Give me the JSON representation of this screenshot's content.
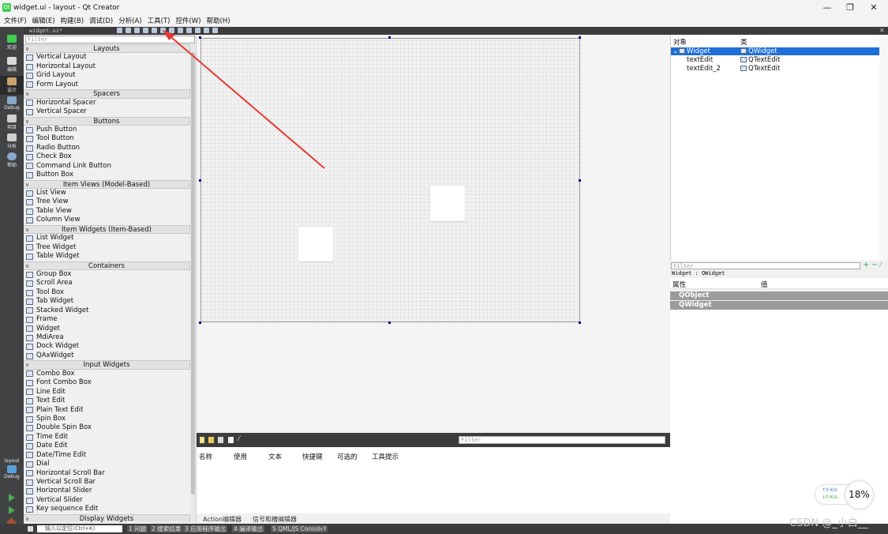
{
  "window": {
    "title": "widget.ui - layout - Qt Creator",
    "app_icon": "Qt",
    "minimize": "—",
    "maximize": "❐",
    "close": "✕"
  },
  "menu": [
    "文件(F)",
    "编辑(E)",
    "构建(B)",
    "调试(D)",
    "分析(A)",
    "工具(T)",
    "控件(W)",
    "帮助(H)"
  ],
  "modes": {
    "welcome": "欢迎",
    "edit": "编辑",
    "design": "设计",
    "debug": "Debug",
    "projects": "项目",
    "analyze": "分析",
    "help": "帮助",
    "kit_label": "layout",
    "kit_mode": "Debug"
  },
  "widget_box": {
    "doc_tab": "widget.ui*",
    "filter_placeholder": "Filter",
    "categories": [
      {
        "name": "Layouts",
        "items": [
          "Vertical Layout",
          "Horizontal Layout",
          "Grid Layout",
          "Form Layout"
        ]
      },
      {
        "name": "Spacers",
        "items": [
          "Horizontal Spacer",
          "Vertical Spacer"
        ]
      },
      {
        "name": "Buttons",
        "items": [
          "Push Button",
          "Tool Button",
          "Radio Button",
          "Check Box",
          "Command Link Button",
          "Button Box"
        ]
      },
      {
        "name": "Item Views (Model-Based)",
        "items": [
          "List View",
          "Tree View",
          "Table View",
          "Column View"
        ]
      },
      {
        "name": "Item Widgets (Item-Based)",
        "items": [
          "List Widget",
          "Tree Widget",
          "Table Widget"
        ]
      },
      {
        "name": "Containers",
        "items": [
          "Group Box",
          "Scroll Area",
          "Tool Box",
          "Tab Widget",
          "Stacked Widget",
          "Frame",
          "Widget",
          "MdiArea",
          "Dock Widget",
          "QAxWidget"
        ]
      },
      {
        "name": "Input Widgets",
        "items": [
          "Combo Box",
          "Font Combo Box",
          "Line Edit",
          "Text Edit",
          "Plain Text Edit",
          "Spin Box",
          "Double Spin Box",
          "Time Edit",
          "Date Edit",
          "Date/Time Edit",
          "Dial",
          "Horizontal Scroll Bar",
          "Vertical Scroll Bar",
          "Horizontal Slider",
          "Vertical Slider",
          "Key sequence Edit"
        ]
      },
      {
        "name": "Display Widgets",
        "items": []
      }
    ]
  },
  "action_editor": {
    "filter_placeholder": "Filter",
    "columns": [
      "名称",
      "使用",
      "文本",
      "快捷键",
      "可选的",
      "工具提示"
    ],
    "tabs": [
      "Action编辑器",
      "信号和槽编辑器"
    ]
  },
  "object_inspector": {
    "col_object": "对象",
    "col_class": "类",
    "rows": [
      {
        "object": "Widget",
        "class": "QWidget",
        "selected": true
      },
      {
        "object": "textEdit",
        "class": "QTextEdit",
        "selected": false
      },
      {
        "object": "textEdit_2",
        "class": "QTextEdit",
        "selected": false
      }
    ]
  },
  "property_editor": {
    "filter_placeholder": "Filter",
    "title": "Widget : QWidget",
    "col_property": "属性",
    "col_value": "值",
    "groups": [
      "QObject",
      "QWidget"
    ]
  },
  "status_bar": {
    "locator_placeholder": "输入以定位(Ctrl+K)",
    "panes": [
      "1 问题",
      "2 搜索结果",
      "3 应用程序输出",
      "4 编译输出",
      "5 QML/JS Console"
    ]
  },
  "overlay": {
    "up_speed": "↑0 K/s",
    "down_speed": "↓0 K/s",
    "cpu_percent": "18%",
    "watermark": "CSDN @_小白__"
  },
  "colors": {
    "selection": "#1e6fd9",
    "annotation_arrow": "#e53935",
    "dark_panel": "#3c3c3c"
  }
}
